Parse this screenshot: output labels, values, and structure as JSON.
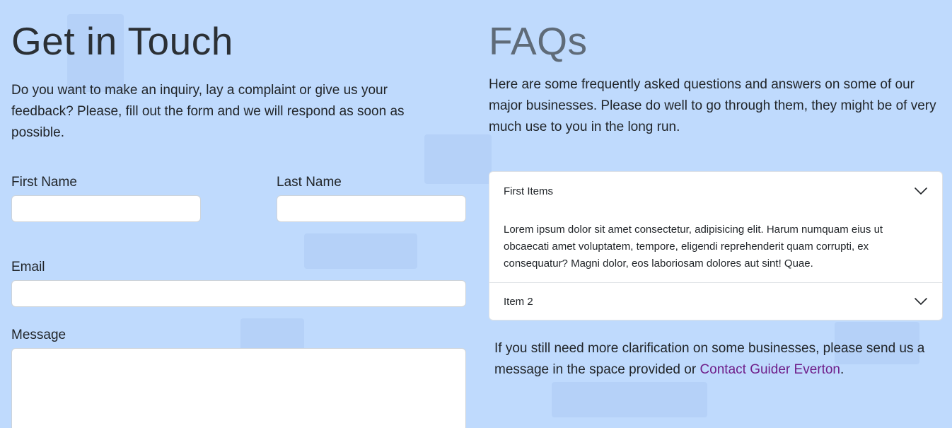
{
  "contact": {
    "title": "Get in Touch",
    "intro": "Do you want to make an inquiry, lay a complaint or give us your feedback? Please, fill out the form and we will respond as soon as possible.",
    "first_name_label": "First Name",
    "first_name_value": "",
    "last_name_label": "Last Name",
    "last_name_value": "",
    "email_label": "Email",
    "email_value": "",
    "message_label": "Message",
    "message_value": ""
  },
  "faq": {
    "title": "FAQs",
    "intro": "Here are some frequently asked questions and answers on some of our major businesses. Please do well to go through them, they might be of very much use to you in the long run.",
    "items": [
      {
        "label": "First Items",
        "body": "Lorem ipsum dolor sit amet consectetur, adipisicing elit. Harum numquam eius ut obcaecati amet voluptatem, tempore, eligendi reprehenderit quam corrupti, ex consequatur? Magni dolor, eos laboriosam dolores aut sint! Quae.",
        "expanded": true
      },
      {
        "label": "Item 2",
        "body": "",
        "expanded": false
      }
    ],
    "closing_text": "If you still need more clarification on some businesses, please send us a message in the space provided or ",
    "closing_link": "Contact Guider Everton",
    "closing_end": "."
  },
  "icons": {
    "accordion_toggle": "chevron-down-icon"
  },
  "colors": {
    "background": "#bfdafd",
    "link": "#6f1f8a",
    "faq_title": "#5f6b78"
  }
}
